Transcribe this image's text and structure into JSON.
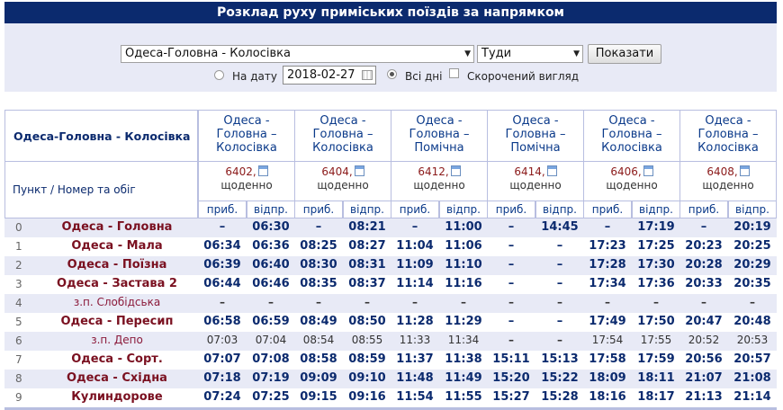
{
  "title": "Розклад руху приміських поїздів за напрямком",
  "form": {
    "route_value": "Одеса-Головна - Колосівка",
    "direction_value": "Туди",
    "show_button": "Показати",
    "date_label": "На дату",
    "date_value": "2018-02-27",
    "all_days_label": "Всі дні",
    "short_view_label": "Скорочений вигляд",
    "date_radio_checked": false,
    "all_days_checked": true,
    "short_view_checked": false
  },
  "table": {
    "route_header": "Одеса-Головна - Колосівка",
    "point_header": "Пункт / Номер та обіг",
    "arr_label": "приб.",
    "dep_label": "відпр.",
    "trains": [
      {
        "dest": "Одеса - Головна – Колосівка",
        "number": "6402,",
        "days": "щоденно"
      },
      {
        "dest": "Одеса - Головна – Колосівка",
        "number": "6404,",
        "days": "щоденно"
      },
      {
        "dest": "Одеса - Головна – Помічна",
        "number": "6412,",
        "days": "щоденно"
      },
      {
        "dest": "Одеса - Головна – Помічна",
        "number": "6414,",
        "days": "щоденно"
      },
      {
        "dest": "Одеса - Головна – Колосівка",
        "number": "6406,",
        "days": "щоденно"
      },
      {
        "dest": "Одеса - Головна – Колосівка",
        "number": "6408,",
        "days": "щоденно"
      }
    ],
    "rows": [
      {
        "n": "0",
        "station": "Одеса - Головна",
        "bold": true,
        "times": [
          "–",
          "06:30",
          "–",
          "08:21",
          "–",
          "11:00",
          "–",
          "14:45",
          "–",
          "17:19",
          "–",
          "20:19"
        ]
      },
      {
        "n": "1",
        "station": "Одеса - Мала",
        "bold": true,
        "times": [
          "06:34",
          "06:36",
          "08:25",
          "08:27",
          "11:04",
          "11:06",
          "–",
          "–",
          "17:23",
          "17:25",
          "20:23",
          "20:25"
        ]
      },
      {
        "n": "2",
        "station": "Одеса - Поїзна",
        "bold": true,
        "times": [
          "06:39",
          "06:40",
          "08:30",
          "08:31",
          "11:09",
          "11:10",
          "–",
          "–",
          "17:28",
          "17:30",
          "20:28",
          "20:29"
        ]
      },
      {
        "n": "3",
        "station": "Одеса - Застава 2",
        "bold": true,
        "times": [
          "06:44",
          "06:46",
          "08:35",
          "08:37",
          "11:14",
          "11:16",
          "–",
          "–",
          "17:34",
          "17:36",
          "20:33",
          "20:35"
        ]
      },
      {
        "n": "4",
        "station": "з.п. Слобідська",
        "bold": false,
        "times": [
          "–",
          "–",
          "–",
          "–",
          "–",
          "–",
          "–",
          "–",
          "–",
          "–",
          "–",
          "–"
        ]
      },
      {
        "n": "5",
        "station": "Одеса - Пересип",
        "bold": true,
        "times": [
          "06:58",
          "06:59",
          "08:49",
          "08:50",
          "11:28",
          "11:29",
          "–",
          "–",
          "17:49",
          "17:50",
          "20:47",
          "20:48"
        ]
      },
      {
        "n": "6",
        "station": "з.п. Депо",
        "bold": false,
        "times": [
          "07:03",
          "07:04",
          "08:54",
          "08:55",
          "11:33",
          "11:34",
          "–",
          "–",
          "17:54",
          "17:55",
          "20:52",
          "20:53"
        ]
      },
      {
        "n": "7",
        "station": "Одеса - Сорт.",
        "bold": true,
        "times": [
          "07:07",
          "07:08",
          "08:58",
          "08:59",
          "11:37",
          "11:38",
          "15:11",
          "15:13",
          "17:58",
          "17:59",
          "20:56",
          "20:57"
        ]
      },
      {
        "n": "8",
        "station": "Одеса - Східна",
        "bold": true,
        "times": [
          "07:18",
          "07:19",
          "09:09",
          "09:10",
          "11:48",
          "11:49",
          "15:20",
          "15:22",
          "18:09",
          "18:11",
          "21:07",
          "21:08"
        ]
      },
      {
        "n": "9",
        "station": "Кулиндорове",
        "bold": true,
        "times": [
          "07:24",
          "07:25",
          "09:15",
          "09:16",
          "11:54",
          "11:55",
          "15:27",
          "15:28",
          "18:16",
          "18:17",
          "21:13",
          "21:14"
        ]
      }
    ]
  },
  "colors": {
    "header_bg": "#0b2a6e",
    "form_bg": "#e8eaf6",
    "row_alt": "#e8eaf6",
    "station_bold": "#7a1020"
  }
}
